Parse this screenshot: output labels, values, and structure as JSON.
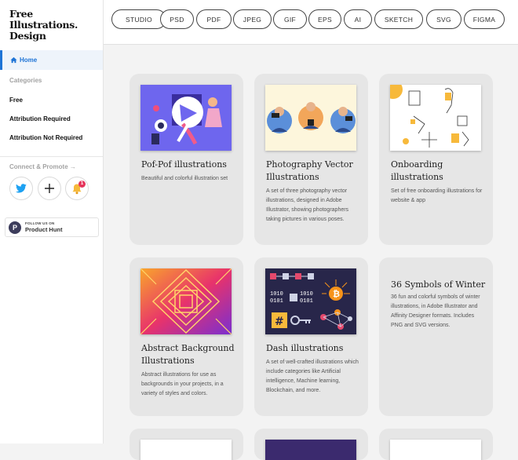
{
  "sidebar": {
    "logo_line1": "Free",
    "logo_line2": "Illustrations.",
    "logo_line3": "Design",
    "home_label": "Home",
    "categories_label": "Categories",
    "items": [
      {
        "label": "Free"
      },
      {
        "label": "Attribution Required"
      },
      {
        "label": "Attribution Not Required"
      }
    ],
    "connect_label": "Connect & Promote →",
    "notification_count": "1",
    "product_hunt": {
      "small": "FOLLOW US ON",
      "big": "Product Hunt",
      "logo_letter": "P"
    }
  },
  "filters": [
    "STUDIO",
    "PSD",
    "PDF",
    "JPEG",
    "GIF",
    "EPS",
    "AI",
    "SKETCH",
    "SVG",
    "FIGMA"
  ],
  "cards": [
    {
      "title": "Pof-Pof illustrations",
      "desc": "Beautiful and colorful illustration set"
    },
    {
      "title": "Photography Vector Illustrations",
      "desc": "A set of three photography vector illustrations, designed in Adobe Illustrator, showing photographers taking pictures in various poses."
    },
    {
      "title": "Onboarding illustrations",
      "desc": "Set of free onboarding illustrations for website & app"
    },
    {
      "title": "Abstract Background Illustrations",
      "desc": "Abstract illustrations for use as backgrounds in your projects, in a variety of styles and colors."
    },
    {
      "title": "Dash illustrations",
      "desc": "A set of well-crafted illustrations which include categories like Artificial intelligence, Machine learning, Blockchain, and more."
    },
    {
      "title": "36 Symbols of Winter",
      "desc": "36 fun and colorful symbols of winter illustrations, in Adobe Illustrator and Affinity Designer formats. Includes PNG and SVG versions."
    }
  ],
  "dash_thumb": {
    "code_line1": "1010",
    "code_line2": "0101",
    "code_line3": "1010",
    "code_line4": "0101",
    "hash": "#",
    "bitcoin": "₿"
  },
  "colors": {
    "accent": "#1e74d6",
    "twitter": "#1da1f2",
    "bell": "#f6b93b",
    "badge": "#e5345b"
  }
}
